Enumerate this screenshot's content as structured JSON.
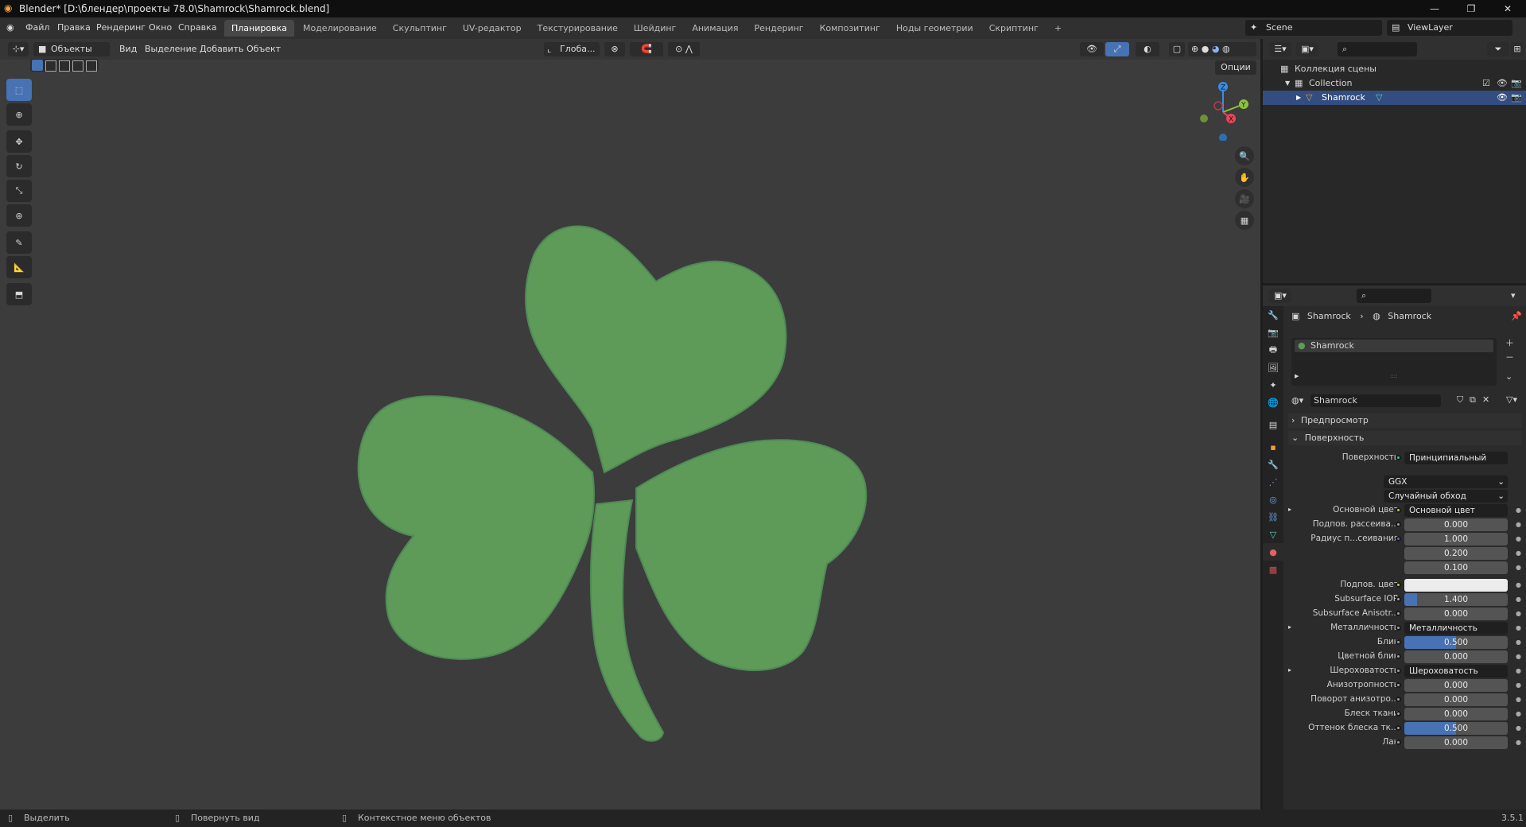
{
  "window": {
    "title": "Blender* [D:\\блендер\\проекты 78.0\\Shamrock\\Shamrock.blend]",
    "controls": [
      "—",
      "❐",
      "✕"
    ]
  },
  "menu": [
    "Файл",
    "Правка",
    "Рендеринг",
    "Окно",
    "Справка"
  ],
  "workspaces": [
    "Планировка",
    "Моделирование",
    "Скульптинг",
    "UV-редактор",
    "Текстурирование",
    "Шейдинг",
    "Анимация",
    "Рендеринг",
    "Композитинг",
    "Ноды геометрии",
    "Скриптинг",
    "+"
  ],
  "scene": {
    "name": "Scene",
    "view_layer": "ViewLayer"
  },
  "viewport": {
    "mode": "Объекты",
    "menus": [
      "Вид",
      "Выделение",
      "Добавить",
      "Объект"
    ],
    "transform_orientation": "Глоба...",
    "options_label": "Опции",
    "gizmo_axes": {
      "z": "Z",
      "y": "Y",
      "x": "X"
    },
    "shape_color": "#5e9a58",
    "shape_edge_color": "#4e8a55"
  },
  "outliner": {
    "root": "Коллекция сцены",
    "collection": "Collection",
    "object": "Shamrock"
  },
  "properties": {
    "breadcrumb_object": "Shamrock",
    "breadcrumb_material": "Shamrock",
    "material_slot": "Shamrock",
    "material_name": "Shamrock",
    "panels": {
      "preview": "Предпросмотр",
      "surface": "Поверхность"
    },
    "surface_label": "Поверхность",
    "surface_value": "Принципиальный BSDF",
    "distribution": "GGX",
    "subsurface_method": "Случайный обход",
    "rows": [
      {
        "label": "Основной цвет",
        "value": "Основной цвет",
        "kind": "link",
        "expand": "▸",
        "socket": "#c7c729"
      },
      {
        "label": "Подпов. рассеива...",
        "value": "0.000",
        "kind": "num",
        "fill": 0,
        "socket": "#a1a1a1"
      },
      {
        "label": "Радиус п...сеивания",
        "value": "1.000",
        "kind": "num",
        "fill": 0,
        "socket": "#6363c7"
      },
      {
        "label": "",
        "value": "0.200",
        "kind": "num",
        "fill": 0
      },
      {
        "label": "",
        "value": "0.100",
        "kind": "num",
        "fill": 0
      },
      {
        "label": "Подпов. цвет",
        "value": "",
        "kind": "color",
        "socket": "#c7c729"
      },
      {
        "label": "Subsurface IOR",
        "value": "1.400",
        "kind": "num",
        "fill": 0.12,
        "socket": "#a1a1a1"
      },
      {
        "label": "Subsurface Anisotr...",
        "value": "0.000",
        "kind": "num",
        "fill": 0,
        "socket": "#a1a1a1"
      },
      {
        "label": "Металличность",
        "value": "Металличность",
        "kind": "link",
        "expand": "▸",
        "socket": "#a1a1a1"
      },
      {
        "label": "Блик",
        "value": "0.500",
        "kind": "num",
        "fill": 0.5,
        "socket": "#a1a1a1"
      },
      {
        "label": "Цветной блик",
        "value": "0.000",
        "kind": "num",
        "fill": 0,
        "socket": "#a1a1a1"
      },
      {
        "label": "Шероховатость",
        "value": "Шероховатость",
        "kind": "link",
        "expand": "▸",
        "socket": "#a1a1a1"
      },
      {
        "label": "Анизотропность",
        "value": "0.000",
        "kind": "num",
        "fill": 0,
        "socket": "#a1a1a1"
      },
      {
        "label": "Поворот анизотро...",
        "value": "0.000",
        "kind": "num",
        "fill": 0,
        "socket": "#a1a1a1"
      },
      {
        "label": "Блеск ткани",
        "value": "0.000",
        "kind": "num",
        "fill": 0,
        "socket": "#a1a1a1"
      },
      {
        "label": "Оттенок блеска тк...",
        "value": "0.500",
        "kind": "num",
        "fill": 0.5,
        "socket": "#a1a1a1"
      },
      {
        "label": "Лак",
        "value": "0.000",
        "kind": "num",
        "fill": 0,
        "socket": "#a1a1a1"
      }
    ]
  },
  "status": {
    "select": "Выделить",
    "rotate": "Повернуть вид",
    "context": "Контекстное меню объектов",
    "version": "3.5.1"
  },
  "colors": {
    "accent": "#4772b3",
    "selection_row": "#334d80",
    "axis_x": "#e8465a",
    "axis_y": "#8bc43c",
    "axis_z": "#3a8de3"
  }
}
